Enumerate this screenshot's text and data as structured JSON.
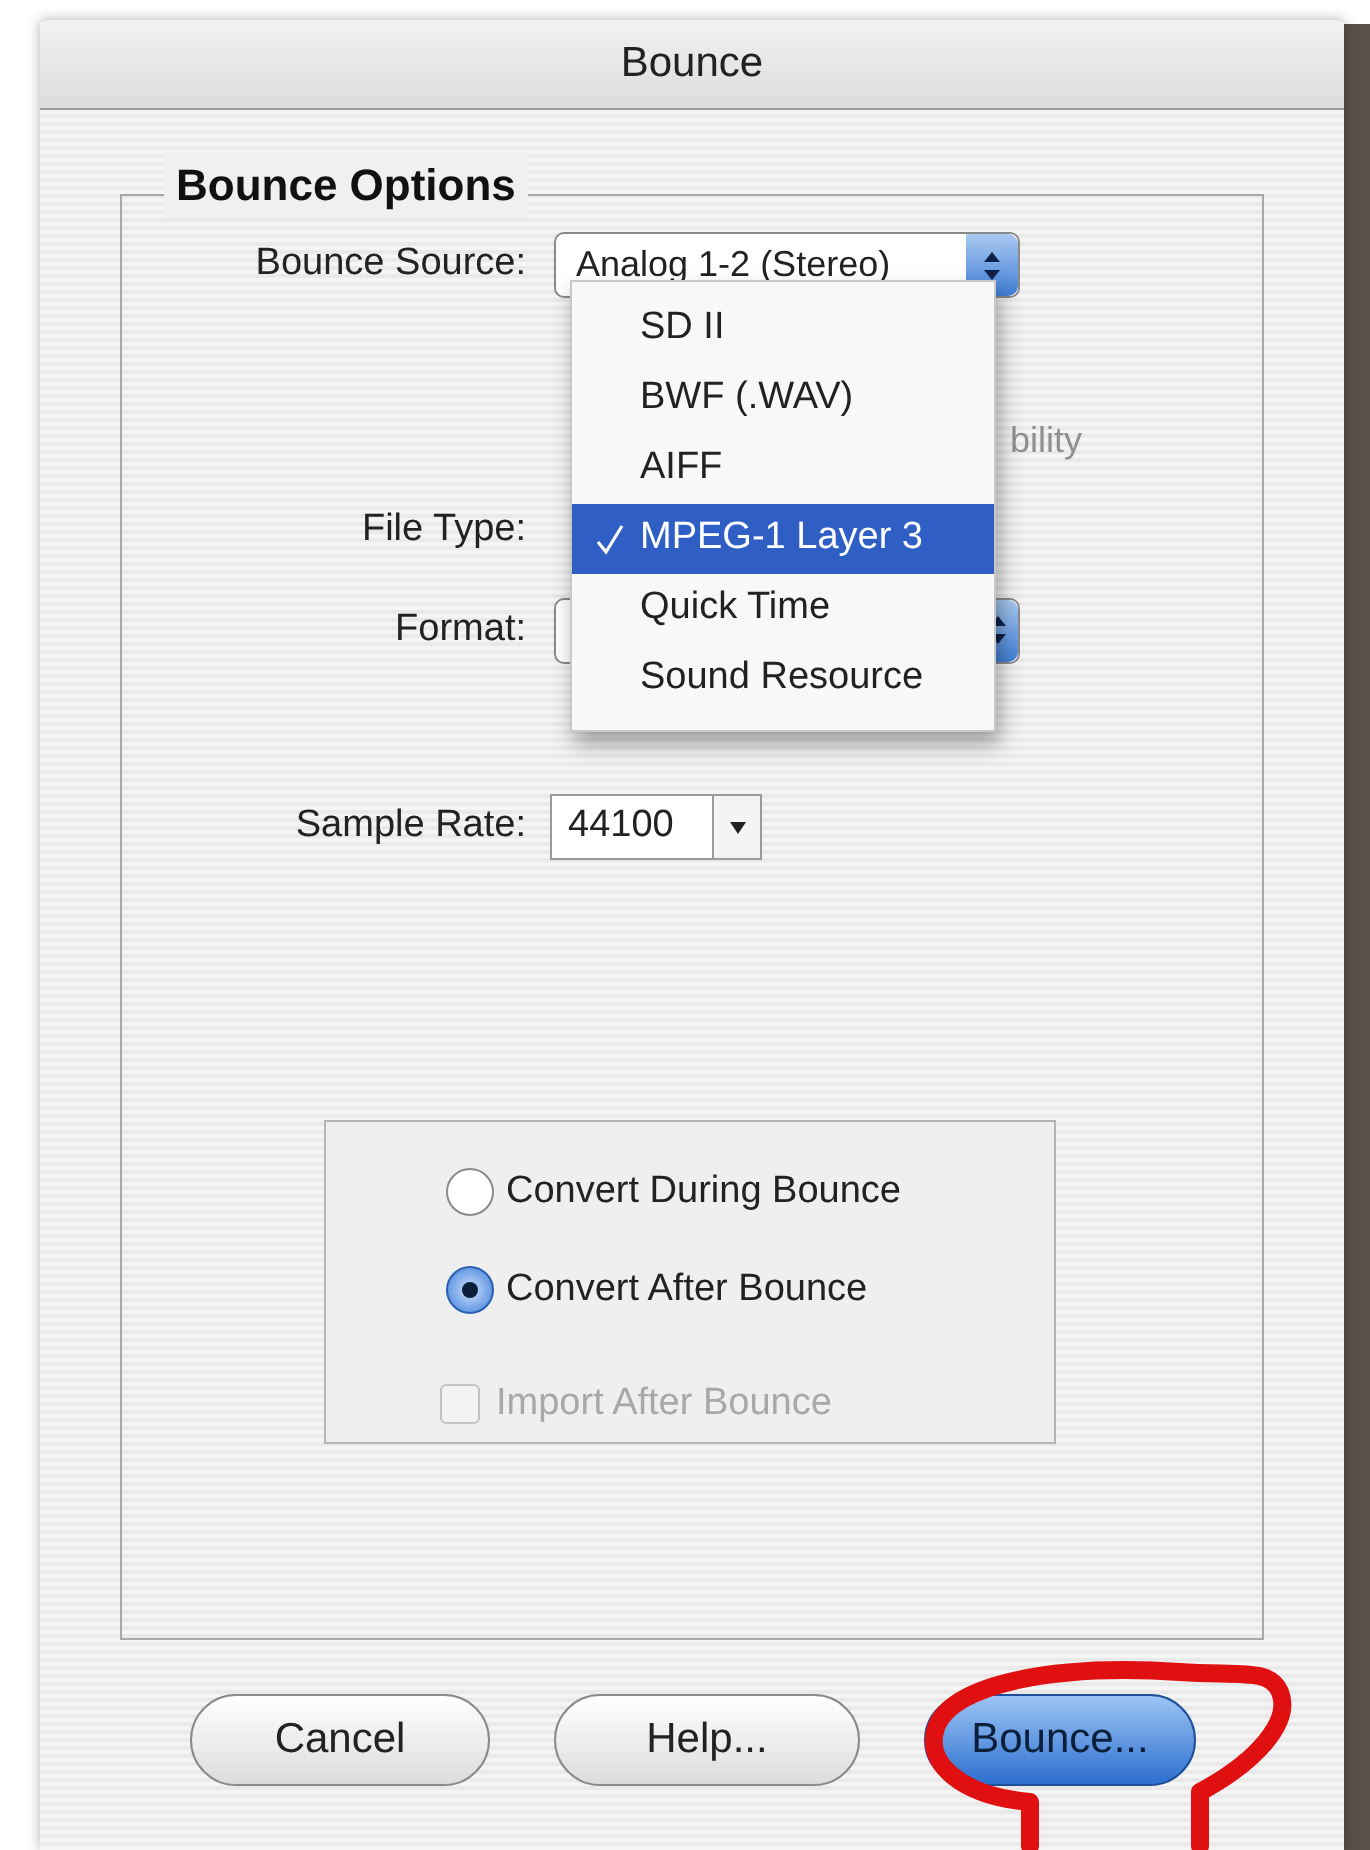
{
  "window": {
    "title": "Bounce"
  },
  "group": {
    "title": "Bounce Options"
  },
  "bounce_source": {
    "label": "Bounce Source:",
    "value": "Analog 1-2 (Stereo)"
  },
  "covered_option": {
    "text": "bility",
    "disabled": true
  },
  "file_type": {
    "label": "File Type:"
  },
  "format": {
    "label": "Format:"
  },
  "sample_rate": {
    "label": "Sample Rate:",
    "value": "44100"
  },
  "file_type_menu": [
    {
      "label": "SD II",
      "selected": false
    },
    {
      "label": "BWF (.WAV)",
      "selected": false
    },
    {
      "label": "AIFF",
      "selected": false
    },
    {
      "label": "MPEG-1 Layer 3",
      "selected": true
    },
    {
      "label": "Quick Time",
      "selected": false
    },
    {
      "label": "Sound Resource",
      "selected": false
    }
  ],
  "convert_options": [
    {
      "label": "Convert During Bounce",
      "selected": false
    },
    {
      "label": "Convert After Bounce",
      "selected": true
    }
  ],
  "import_checkbox": {
    "label": "Import After Bounce",
    "checked": false,
    "disabled": true
  },
  "buttons": [
    {
      "label": "Cancel",
      "default": false
    },
    {
      "label": "Help...",
      "default": false
    },
    {
      "label": "Bounce...",
      "default": true
    }
  ],
  "annotation": {
    "kind": "red_circle"
  }
}
